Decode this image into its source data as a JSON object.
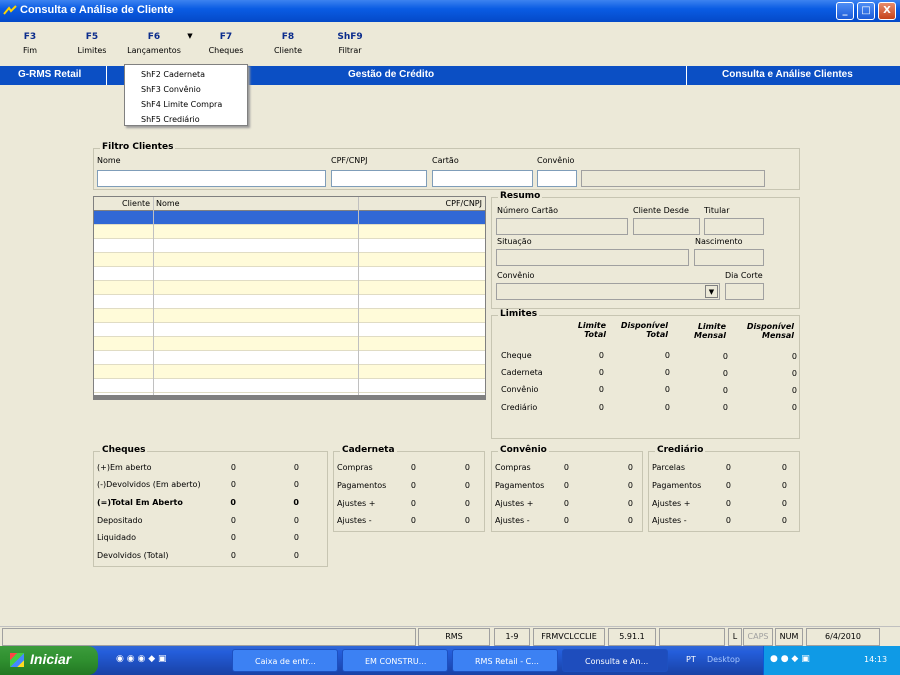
{
  "window": {
    "title": "Consulta e Análise de Cliente",
    "min": "_",
    "max": "□",
    "close": "X"
  },
  "toolbar": [
    {
      "key": "F3",
      "label": "Fim"
    },
    {
      "key": "F5",
      "label": "Limites"
    },
    {
      "key": "F6",
      "label": "Lançamentos"
    },
    {
      "key": "F7",
      "label": "Cheques"
    },
    {
      "key": "F8",
      "label": "Cliente"
    },
    {
      "key": "ShF9",
      "label": "Filtrar"
    }
  ],
  "header": {
    "left": "G-RMS Retail",
    "center": "Gestão de Crédito",
    "right": "Consulta e Análise Clientes"
  },
  "dropdown": [
    "ShF2  Caderneta",
    "ShF3  Convênio",
    "ShF4  Limite Compra",
    "ShF5  Crediário"
  ],
  "filtro": {
    "title": "Filtro Clientes",
    "nome": "Nome",
    "cpf": "CPF/CNPJ",
    "cartao": "Cartão",
    "convenio": "Convênio"
  },
  "grid": {
    "cols": [
      "Cliente",
      "Nome",
      "CPF/CNPJ"
    ]
  },
  "resumo": {
    "title": "Resumo",
    "numero_cartao": "Número Cartão",
    "cliente_desde": "Cliente Desde",
    "titular": "Titular",
    "situacao": "Situação",
    "nascimento": "Nascimento",
    "convenio": "Convênio",
    "dia_corte": "Dia Corte"
  },
  "limites": {
    "title": "Limites",
    "h1a": "Limite",
    "h1b": "Total",
    "h2a": "Disponível",
    "h2b": "Total",
    "h3a": "Limite",
    "h3b": "Mensal",
    "h4a": "Disponível",
    "h4b": "Mensal",
    "rows": [
      {
        "label": "Cheque",
        "v": [
          "0",
          "0",
          "0",
          "0"
        ]
      },
      {
        "label": "Caderneta",
        "v": [
          "0",
          "0",
          "0",
          "0"
        ]
      },
      {
        "label": "Convênio",
        "v": [
          "0",
          "0",
          "0",
          "0"
        ]
      },
      {
        "label": "Crediário",
        "v": [
          "0",
          "0",
          "0",
          "0"
        ]
      }
    ]
  },
  "cheques": {
    "title": "Cheques",
    "rows": [
      {
        "label": "(+)Em aberto",
        "a": "0",
        "b": "0"
      },
      {
        "label": "(-)Devolvidos (Em aberto)",
        "a": "0",
        "b": "0"
      },
      {
        "label": "(=)Total Em Aberto",
        "a": "0",
        "b": "0"
      },
      {
        "label": "Depositado",
        "a": "0",
        "b": "0"
      },
      {
        "label": "Liquidado",
        "a": "0",
        "b": "0"
      },
      {
        "label": "Devolvidos (Total)",
        "a": "0",
        "b": "0"
      }
    ]
  },
  "caderneta": {
    "title": "Caderneta",
    "rows": [
      {
        "label": "Compras",
        "a": "0",
        "b": "0"
      },
      {
        "label": "Pagamentos",
        "a": "0",
        "b": "0"
      },
      {
        "label": "Ajustes +",
        "a": "0",
        "b": "0"
      },
      {
        "label": "Ajustes -",
        "a": "0",
        "b": "0"
      }
    ]
  },
  "convenio": {
    "title": "Convênio",
    "rows": [
      {
        "label": "Compras",
        "a": "0",
        "b": "0"
      },
      {
        "label": "Pagamentos",
        "a": "0",
        "b": "0"
      },
      {
        "label": "Ajustes +",
        "a": "0",
        "b": "0"
      },
      {
        "label": "Ajustes -",
        "a": "0",
        "b": "0"
      }
    ]
  },
  "crediario": {
    "title": "Crediário",
    "rows": [
      {
        "label": "Parcelas",
        "a": "0",
        "b": "0"
      },
      {
        "label": "Pagamentos",
        "a": "0",
        "b": "0"
      },
      {
        "label": "Ajustes +",
        "a": "0",
        "b": "0"
      },
      {
        "label": "Ajustes -",
        "a": "0",
        "b": "0"
      }
    ]
  },
  "status": {
    "rms": "RMS",
    "page": "1-9",
    "form": "FRMVCLCCLIE",
    "version": "5.91.1",
    "l": "L",
    "caps": "CAPS",
    "num": "NUM",
    "date": "6/4/2010"
  },
  "taskbar": {
    "start": "Iniciar",
    "items": [
      "Caixa de entr...",
      "EM CONSTRU...",
      "RMS Retail - C...",
      "Consulta e An..."
    ],
    "lang": "PT",
    "desktop": "Desktop",
    "time": "14:13"
  },
  "colors": {
    "titlebar": "#0a5ce3",
    "header": "#0b4fc4",
    "selected_row": "#3168d5",
    "alt_row": "#fffbd9"
  }
}
